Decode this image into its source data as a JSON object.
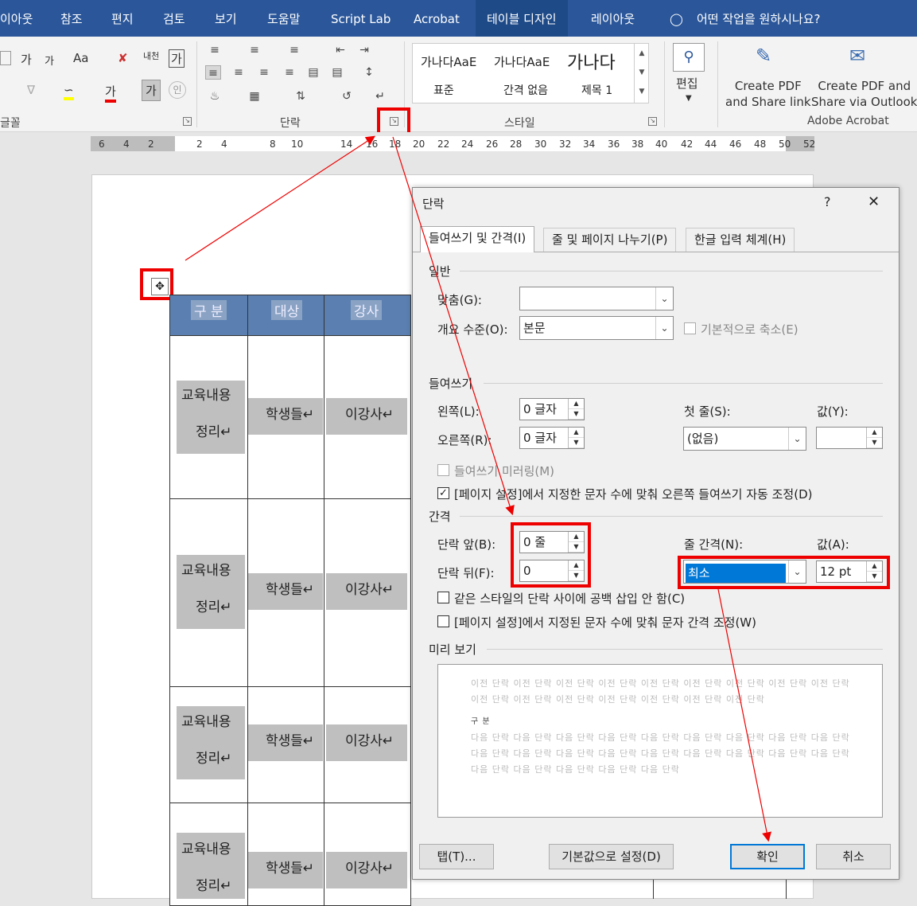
{
  "ribbon_tabs": [
    "이아웃",
    "참조",
    "편지",
    "검토",
    "보기",
    "도움말",
    "Script Lab",
    "Acrobat",
    "테이블 디자인",
    "레이아웃"
  ],
  "ribbon_search": "어떤 작업을 원하시나요?",
  "ribbon": {
    "font_group": "글꼴",
    "paragraph_group": "단락",
    "styles_group": "스타일",
    "styles": [
      {
        "preview": "가나다AaE",
        "name": "표준"
      },
      {
        "preview": "가나다AaE",
        "name": "간격 없음"
      },
      {
        "preview": "가나다",
        "name": "제목 1"
      }
    ],
    "edit_label": "편집",
    "create_pdf_share": "Create PDF\nand Share link",
    "create_pdf_outlook": "Create PDF and\nShare via Outlook",
    "adobe_group": "Adobe Acrobat",
    "font_btn_a": "가",
    "font_btn_b": "가",
    "font_btn_aa": "Aa",
    "font_btn_hanja": "내천",
    "font_btn_gabox": "가",
    "font_btn_ga2": "가",
    "font_btn_in": "인"
  },
  "ruler": [
    "6",
    "4",
    "2",
    "2",
    "4",
    "8",
    "10",
    "14",
    "16",
    "18",
    "20",
    "22",
    "24",
    "26",
    "28",
    "30",
    "32",
    "34",
    "36",
    "38",
    "40",
    "42",
    "44",
    "46",
    "48",
    "50",
    "52"
  ],
  "table": {
    "headers": [
      "구 분",
      "대상",
      "강사"
    ],
    "rows": [
      {
        "item1": "교육내용",
        "item2": "정리↵",
        "target": "학생들↵",
        "teacher": "이강사↵"
      },
      {
        "item1": "교육내용",
        "item2": "정리↵",
        "target": "학생들↵",
        "teacher": "이강사↵"
      },
      {
        "item1": "교육내용",
        "item2": "정리↵",
        "target": "학생들↵",
        "teacher": "이강사↵"
      },
      {
        "item1": "교육내용",
        "item2": "정리↵",
        "target": "학생들↵",
        "teacher": "이강사↵"
      }
    ]
  },
  "dialog": {
    "title": "단락",
    "help": "?",
    "close": "✕",
    "tabs": [
      "들여쓰기 및 간격(I)",
      "줄 및 페이지 나누기(P)",
      "한글 입력 체계(H)"
    ],
    "general": {
      "section": "일반",
      "align_label": "맞춤(G):",
      "align_value": "",
      "outline_label": "개요 수준(O):",
      "outline_value": "본문",
      "collapse_label": "기본적으로 축소(E)"
    },
    "indent": {
      "section": "들여쓰기",
      "left_label": "왼쪽(L):",
      "left_value": "0 글자",
      "right_label": "오른쪽(R):",
      "right_value": "0 글자",
      "first_label": "첫 줄(S):",
      "first_value": "(없음)",
      "by_label": "값(Y):",
      "by_value": "",
      "mirror_label": "들여쓰기 미러링(M)",
      "auto_label": "[페이지 설정]에서 지정한 문자 수에 맞춰 오른쪽 들여쓰기 자동 조정(D)"
    },
    "spacing": {
      "section": "간격",
      "before_label": "단락 앞(B):",
      "before_value": "0 줄",
      "after_label": "단락 뒤(F):",
      "after_value": "0",
      "line_label": "줄 간격(N):",
      "line_value": "최소",
      "at_label": "값(A):",
      "at_value": "12 pt",
      "nospace_label": "같은 스타일의 단락 사이에 공백 삽입 안 함(C)",
      "grid_label": "[페이지 설정]에서 지정된 문자 수에 맞춰 문자 간격 조정(W)"
    },
    "preview": {
      "section": "미리 보기",
      "prev1": "이전 단락 이전 단락 이전 단락 이전 단락 이전 단락 이전 단락 이전 단락 이전 단락 이전 단락",
      "prev2": "이전 단락 이전 단락 이전 단락 이전 단락 이전 단락 이전 단락 이전 단락",
      "current": "구 분",
      "next1": "다음 단락 다음 단락 다음 단락 다음 단락 다음 단락 다음 단락 다음 단락 다음 단락 다음 단락",
      "next2": "다음 단락 다음 단락 다음 단락 다음 단락 다음 단락 다음 단락 다음 단락 다음 단락 다음 단락",
      "next3": "다음 단락 다음 단락 다음 단락 다음 단락 다음 단락"
    },
    "buttons": {
      "tabs": "탭(T)...",
      "default": "기본값으로 설정(D)",
      "ok": "확인",
      "cancel": "취소"
    }
  },
  "colors": {
    "ribbon": "#2b579a",
    "highlight": "#ee0000",
    "header_cell": "#5a7fb0"
  }
}
